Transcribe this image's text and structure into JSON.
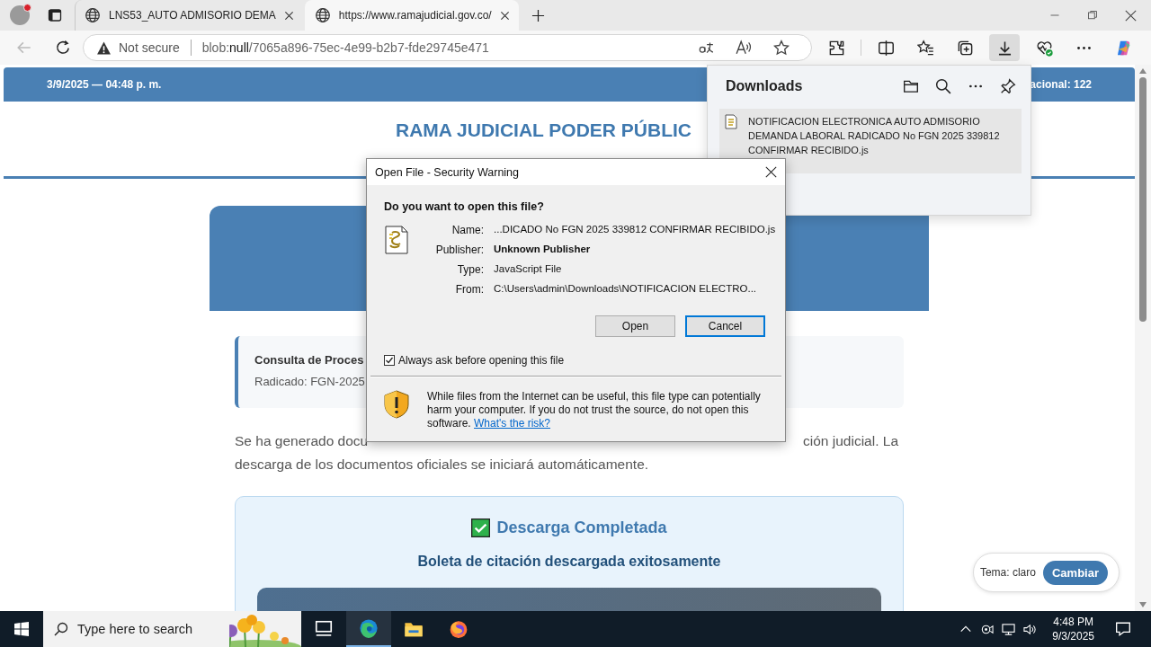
{
  "tabs": [
    {
      "title": "LNS53_AUTO ADMISORIO DEMA",
      "selected": false
    },
    {
      "title": "https://www.ramajudicial.gov.co/",
      "selected": true
    }
  ],
  "address_bar": {
    "security": "Not secure",
    "url": "blob:**null**/7065a896-75ec-4e99-b2b7-fde29745e471"
  },
  "toolbar_buttons": [
    {
      "kind": "extensions",
      "selected": false
    },
    {
      "kind": "split",
      "selected": false
    },
    {
      "kind": "favorites",
      "selected": false
    },
    {
      "kind": "collections",
      "selected": false
    },
    {
      "kind": "downloads",
      "selected": true
    },
    {
      "kind": "health",
      "selected": false
    },
    {
      "kind": "more",
      "selected": false
    },
    {
      "kind": "copilot",
      "selected": false
    }
  ],
  "page": {
    "header_date": "3/9/2025 — 04:48 p. m.",
    "header_right": "acional: 122",
    "title": "RAMA JUDICIAL PODER PÚBLIC",
    "case_box": {
      "title": "Consulta de Proces",
      "line": "Radicado: FGN-2025"
    },
    "paragraph_start": "Se ha generado docu",
    "paragraph_end": "ción judicial. La",
    "paragraph_line2": "descarga de los documentos oficiales se iniciará automáticamente.",
    "success_title": "Descarga Completada",
    "success_subtitle": "Boleta de citación descargada exitosamente",
    "theme_label": "Tema: claro",
    "theme_button": "Cambiar"
  },
  "downloads": {
    "title": "Downloads",
    "items": [
      {
        "name": "NOTIFICACION ELECTRONICA AUTO ADMISORIO DEMANDA LABORAL RADICADO No FGN 2025 339812 CONFIRMAR RECIBIDO.js"
      }
    ]
  },
  "dialog": {
    "title": "Open File - Security Warning",
    "question": "Do you want to open this file?",
    "fields": [
      {
        "label": "Name:",
        "value": "...DICADO No FGN 2025 339812 CONFIRMAR RECIBIDO.js",
        "kind": "plain"
      },
      {
        "label": "Publisher:",
        "value": "Unknown Publisher",
        "kind": "strong"
      },
      {
        "label": "Type:",
        "value": "JavaScript File",
        "kind": "plain"
      },
      {
        "label": "From:",
        "value": "C:\\Users\\admin\\Downloads\\NOTIFICACION ELECTRO...",
        "kind": "plain"
      }
    ],
    "buttons": [
      {
        "label": "Open",
        "selected": false
      },
      {
        "label": "Cancel",
        "selected": true
      }
    ],
    "checkbox": {
      "label": "Always ask before opening this file",
      "checked": true
    },
    "warning": "While files from the Internet can be useful, this file type can potentially harm your computer. If you do not trust the source, do not open this software.",
    "risk_link": "What's the risk?"
  },
  "taskbar": {
    "search_placeholder": "Type here to search",
    "apps": [
      {
        "kind": "task_view",
        "selected": false
      },
      {
        "kind": "edge",
        "selected": true
      },
      {
        "kind": "explorer",
        "selected": false
      },
      {
        "kind": "firefox",
        "selected": false
      }
    ],
    "time": "4:48 PM",
    "date": "9/3/2025"
  }
}
